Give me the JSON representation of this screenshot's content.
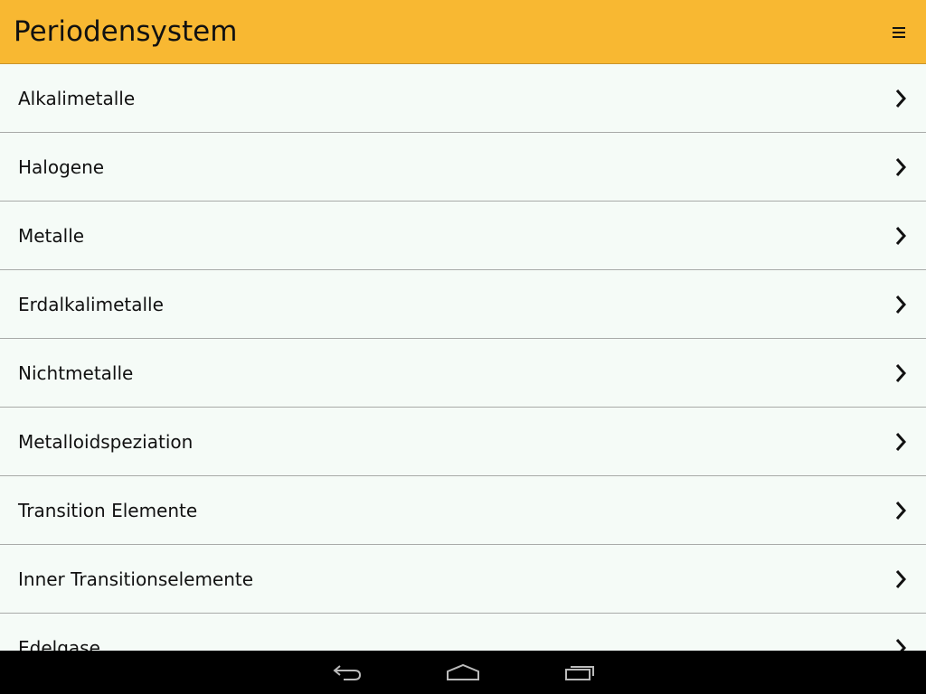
{
  "app_bar": {
    "title": "Periodensystem",
    "menu_icon": "hamburger-menu-icon",
    "background_color": "#f8b832"
  },
  "list": {
    "items": [
      {
        "label": "Alkalimetalle",
        "icon": "chevron-right-icon"
      },
      {
        "label": "Halogene",
        "icon": "chevron-right-icon"
      },
      {
        "label": "Metalle",
        "icon": "chevron-right-icon"
      },
      {
        "label": "Erdalkalimetalle",
        "icon": "chevron-right-icon"
      },
      {
        "label": "Nichtmetalle",
        "icon": "chevron-right-icon"
      },
      {
        "label": "Metalloidspeziation",
        "icon": "chevron-right-icon"
      },
      {
        "label": "Transition Elemente",
        "icon": "chevron-right-icon"
      },
      {
        "label": "Inner Transitionselemente",
        "icon": "chevron-right-icon"
      },
      {
        "label": "Edelgase",
        "icon": "chevron-right-icon"
      }
    ]
  },
  "nav_bar": {
    "back_icon": "back-icon",
    "home_icon": "home-icon",
    "recents_icon": "recent-apps-icon"
  }
}
